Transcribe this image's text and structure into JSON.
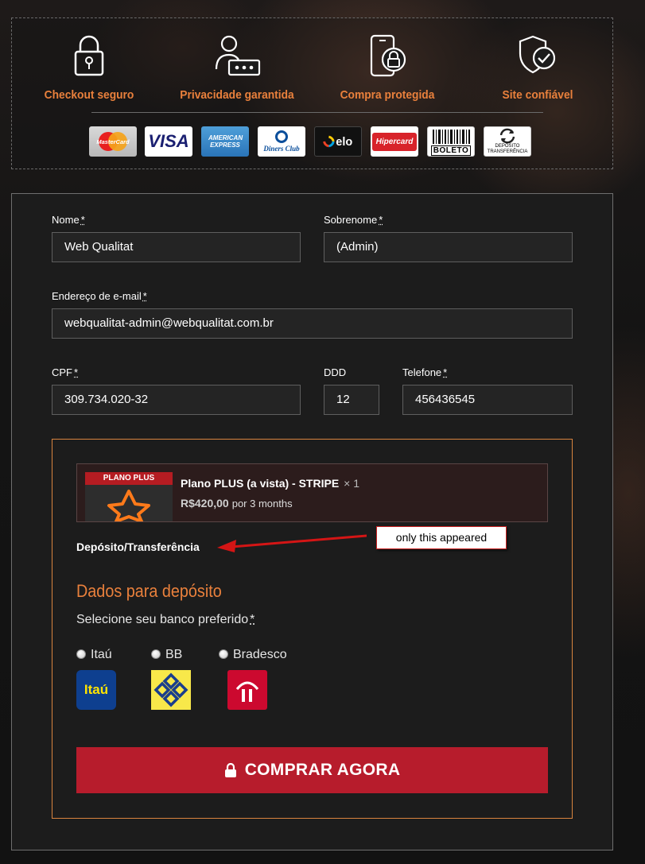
{
  "trust": {
    "badges": [
      {
        "label": "Checkout seguro",
        "icon": "padlock-icon"
      },
      {
        "label": "Privacidade garantida",
        "icon": "user-password-icon"
      },
      {
        "label": "Compra protegida",
        "icon": "secure-phone-icon"
      },
      {
        "label": "Site confiável",
        "icon": "shield-check-icon"
      }
    ],
    "cards": {
      "mastercard": "MasterCard",
      "visa": "VISA",
      "amex": "AMERICAN EXPRESS",
      "diners": "Diners Club",
      "elo": "elo",
      "hipercard": "Hipercard",
      "boleto": "BOLETO",
      "deposito": "DEPÓSITO TRANSFERÊNCIA"
    }
  },
  "form": {
    "nome": {
      "label": "Nome",
      "value": "Web Qualitat"
    },
    "sobrenome": {
      "label": "Sobrenome",
      "value": "(Admin)"
    },
    "email": {
      "label": "Endereço de e-mail",
      "value": "webqualitat-admin@webqualitat.com.br"
    },
    "cpf": {
      "label": "CPF",
      "value": "309.734.020-32"
    },
    "ddd": {
      "label": "DDD",
      "value": "12"
    },
    "telefone": {
      "label": "Telefone",
      "value": "456436545"
    },
    "required_mark": "*"
  },
  "order": {
    "product": {
      "thumb_label": "PLANO PLUS",
      "name": "Plano PLUS (a vista) - STRIPE",
      "qty": "× 1",
      "price": "R$420,00",
      "period": "por 3 months"
    },
    "payment_method": "Depósito/Transferência",
    "annotation": "only this appeared",
    "deposit_title": "Dados para depósito",
    "bank_prompt": "Selecione seu banco preferido",
    "banks": [
      {
        "label": "Itaú",
        "logo_text": "Itaú"
      },
      {
        "label": "BB"
      },
      {
        "label": "Bradesco"
      }
    ],
    "buy_button": "COMPRAR AGORA"
  },
  "colors": {
    "accent_orange": "#e9803c",
    "buy_red": "#b71c2c",
    "annotation_red": "#d41515"
  }
}
